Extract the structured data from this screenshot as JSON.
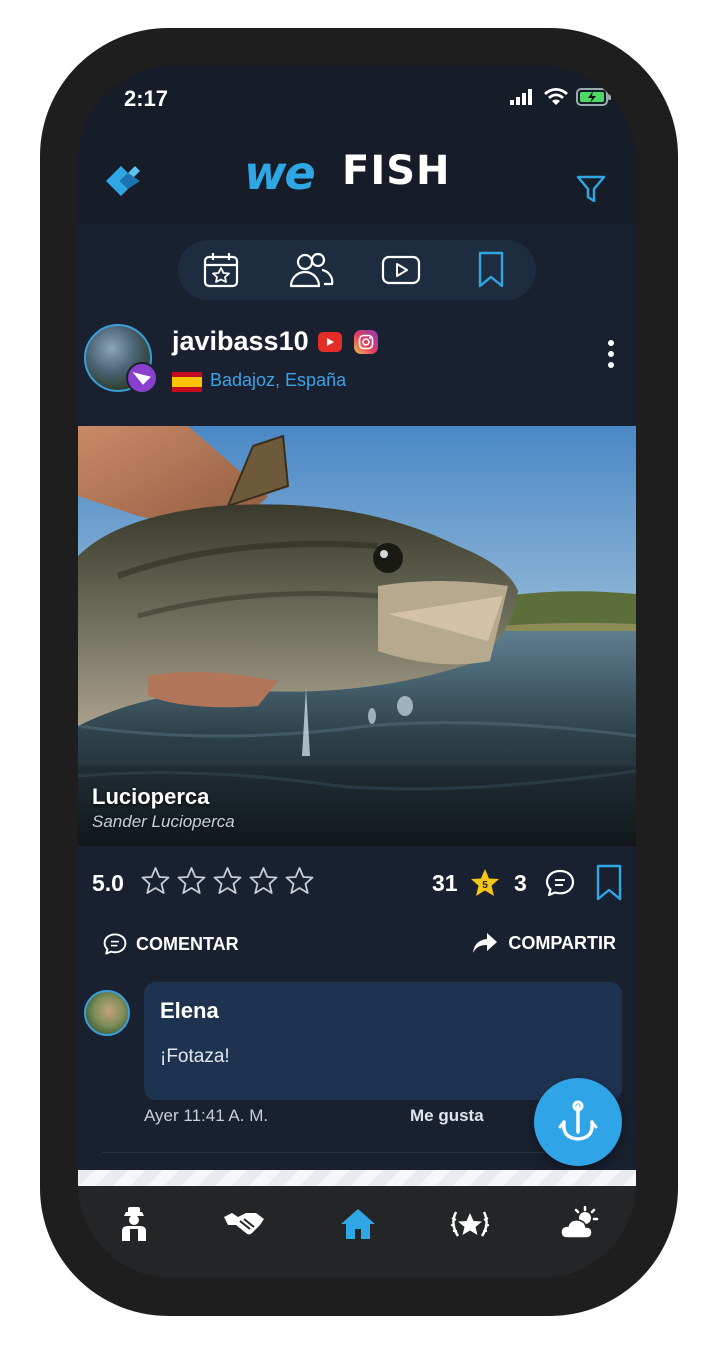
{
  "status_bar": {
    "time": "2:17",
    "icons": [
      "signal-icon",
      "wifi-icon",
      "battery-charging-icon"
    ]
  },
  "header": {
    "back_icon": "back-chevrons-icon",
    "logo_we": "we",
    "logo_fish": "FISH",
    "filter_icon": "filter-funnel-icon"
  },
  "tabs": [
    {
      "icon": "calendar-star-icon",
      "active": false
    },
    {
      "icon": "users-icon",
      "active": false
    },
    {
      "icon": "video-play-icon",
      "active": false
    },
    {
      "icon": "bookmark-icon",
      "active": true
    }
  ],
  "post": {
    "username": "javibass10",
    "location": "Badajoz, España",
    "country_flag": "spain-flag",
    "social": [
      "youtube-icon",
      "instagram-icon"
    ],
    "species_name": "Lucioperca",
    "species_scientific": "Sander Lucioperca",
    "rating_score": "5.0",
    "rating_stars": 0,
    "rating_max": 5,
    "likes_count": "31",
    "star_badge_value": "5",
    "comments_count": "3",
    "comment_action": "COMENTAR",
    "share_action": "COMPARTIR"
  },
  "comments": [
    {
      "author": "Elena",
      "text": "¡Fotaza!",
      "time": "Ayer 11:41 A. M.",
      "like_label": "Me gusta"
    }
  ],
  "fab": {
    "icon": "fishing-hook-icon"
  },
  "bottom_nav": [
    {
      "icon": "fisherman-icon",
      "active": false
    },
    {
      "icon": "handshake-icon",
      "active": false
    },
    {
      "icon": "home-icon",
      "active": true
    },
    {
      "icon": "star-laurel-icon",
      "active": false
    },
    {
      "icon": "weather-sun-cloud-icon",
      "active": false
    }
  ],
  "colors": {
    "accent": "#2fa7e4",
    "background": "#19202f",
    "bubble": "#1e3350",
    "nav_bg": "#232527",
    "star_gold": "#f5c518"
  }
}
